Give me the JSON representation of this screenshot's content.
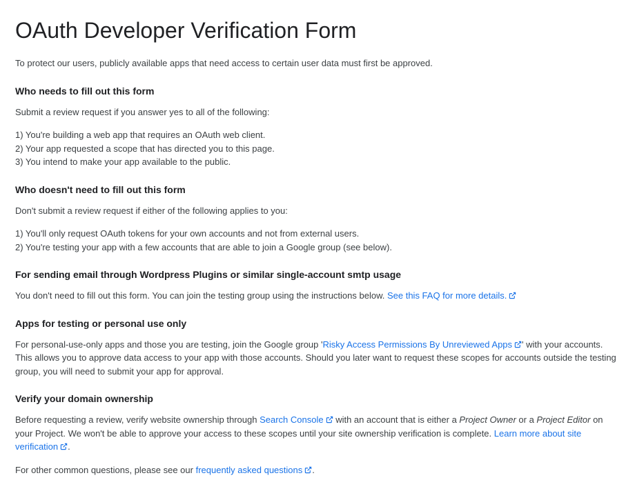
{
  "title": "OAuth Developer Verification Form",
  "intro": "To protect our users, publicly available apps that need access to certain user data must first be approved.",
  "who_needs": {
    "heading": "Who needs to fill out this form",
    "lead": "Submit a review request if you answer yes to all of the following:",
    "items": [
      "1) You're building a web app that requires an OAuth web client.",
      "2) Your app requested a scope that has directed you to this page.",
      "3) You intend to make your app available to the public."
    ]
  },
  "who_doesnt": {
    "heading": "Who doesn't need to fill out this form",
    "lead": "Don't submit a review request if either of the following applies to you:",
    "items": [
      "1) You'll only request OAuth tokens for your own accounts and not from external users.",
      "2) You're testing your app with a few accounts that are able to join a Google group (see below)."
    ]
  },
  "smtp": {
    "heading": "For sending email through Wordpress Plugins or similar single-account smtp usage",
    "text": "You don't need to fill out this form. You can join the testing group using the instructions below. ",
    "link": "See this FAQ for more details."
  },
  "testing": {
    "heading": "Apps for testing or personal use only",
    "text_before": "For personal-use-only apps and those you are testing, join the Google group '",
    "link": "Risky Access Permissions By Unreviewed Apps",
    "text_after": "' with your accounts. This allows you to approve data access to your app with those accounts. Should you later want to request these scopes for accounts outside the testing group, you will need to submit your app for approval."
  },
  "verify": {
    "heading": "Verify your domain ownership",
    "text_before": "Before requesting a review, verify website ownership through ",
    "link1": "Search Console",
    "text_mid1": " with an account that is either a ",
    "italic1": "Project Owner",
    "text_mid2": " or a ",
    "italic2": "Project Editor",
    "text_mid3": " on your Project. We won't be able to approve your access to these scopes until your site ownership verification is complete. ",
    "link2": "Learn more about site verification",
    "period": "."
  },
  "faq": {
    "text": "For other common questions, please see our ",
    "link": "frequently asked questions",
    "period": "."
  }
}
